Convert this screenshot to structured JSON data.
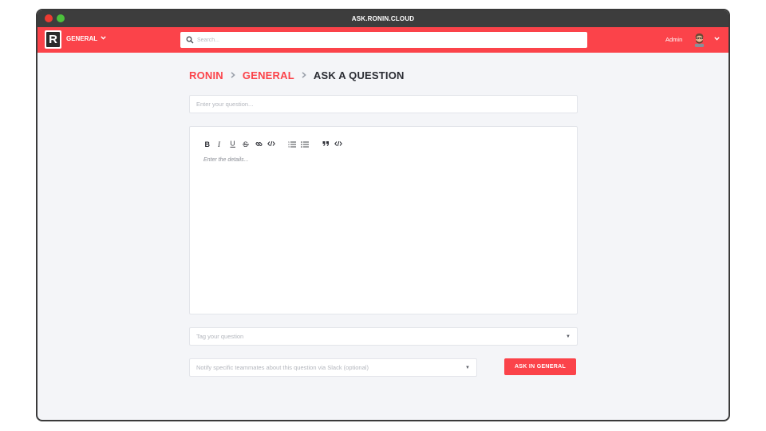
{
  "window": {
    "title": "ASK.RONIN.CLOUD"
  },
  "navbar": {
    "logo_letter": "R",
    "team": "GENERAL",
    "search_placeholder": "Search...",
    "user_name": "Admin",
    "brand_color": "#fb434a"
  },
  "breadcrumb": {
    "root": "RONIN",
    "team": "GENERAL",
    "current": "ASK A QUESTION"
  },
  "form": {
    "question_placeholder": "Enter your question...",
    "editor_toolbar": [
      "bold",
      "italic",
      "underline",
      "strikethrough",
      "link",
      "code",
      "ordered-list",
      "bullet-list",
      "blockquote",
      "code-block"
    ],
    "editor_placeholder": "Enter the details...",
    "tags_placeholder": "Tag your question",
    "notify_placeholder": "Notify specific teammates about this question via Slack (optional)",
    "submit_label": "ASK IN GENERAL"
  }
}
